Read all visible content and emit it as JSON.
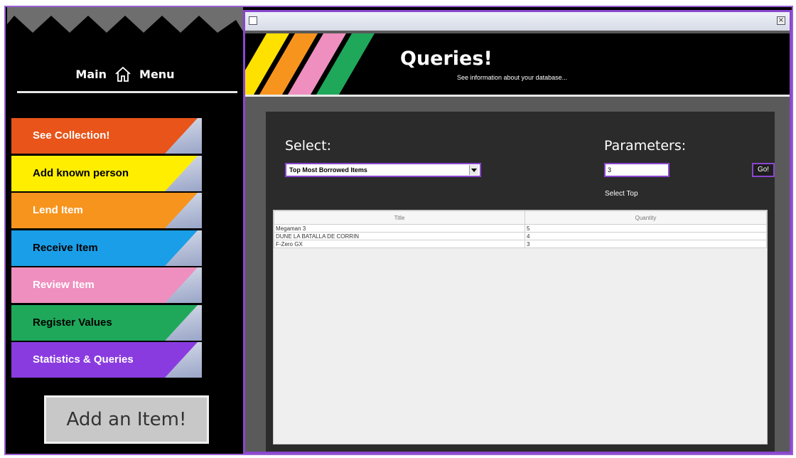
{
  "sidebar": {
    "title_left": "Main",
    "title_right": "Menu",
    "home_icon": "home-icon",
    "items": [
      {
        "label": "See Collection!",
        "color": "#e8541a",
        "text_color": "#ffffff"
      },
      {
        "label": "Add known person",
        "color": "#ffee00",
        "text_color": "#000000"
      },
      {
        "label": "Lend Item",
        "color": "#f7941d",
        "text_color": "#ffffff"
      },
      {
        "label": "Receive Item",
        "color": "#1a9ee8",
        "text_color": "#000000"
      },
      {
        "label": "Review Item",
        "color": "#ee8fbf",
        "text_color": "#ffffff"
      },
      {
        "label": "Register Values",
        "color": "#1fa85a",
        "text_color": "#000000"
      },
      {
        "label": "Statistics & Queries",
        "color": "#8a3be0",
        "text_color": "#ffffff"
      }
    ],
    "add_button": "Add an Item!"
  },
  "window": {
    "title": "Queries!",
    "subtitle": "See information about your database...",
    "stripe_colors": [
      "#ffe100",
      "#f7941d",
      "#ee8fbf",
      "#1fa85a"
    ],
    "accent": "#8a46d0"
  },
  "queries": {
    "select_label": "Select:",
    "select_value": "Top Most Borrowed Items",
    "parameters_label": "Parameters:",
    "parameter_value": "3",
    "go_label": "Go!",
    "hint": "Select Top",
    "columns": [
      "Title",
      "Quantity"
    ],
    "rows": [
      [
        "Megaman 3",
        "5"
      ],
      [
        "DUNE LA BATALLA DE CORRIN",
        "4"
      ],
      [
        "F-Zero GX",
        "3"
      ]
    ]
  }
}
